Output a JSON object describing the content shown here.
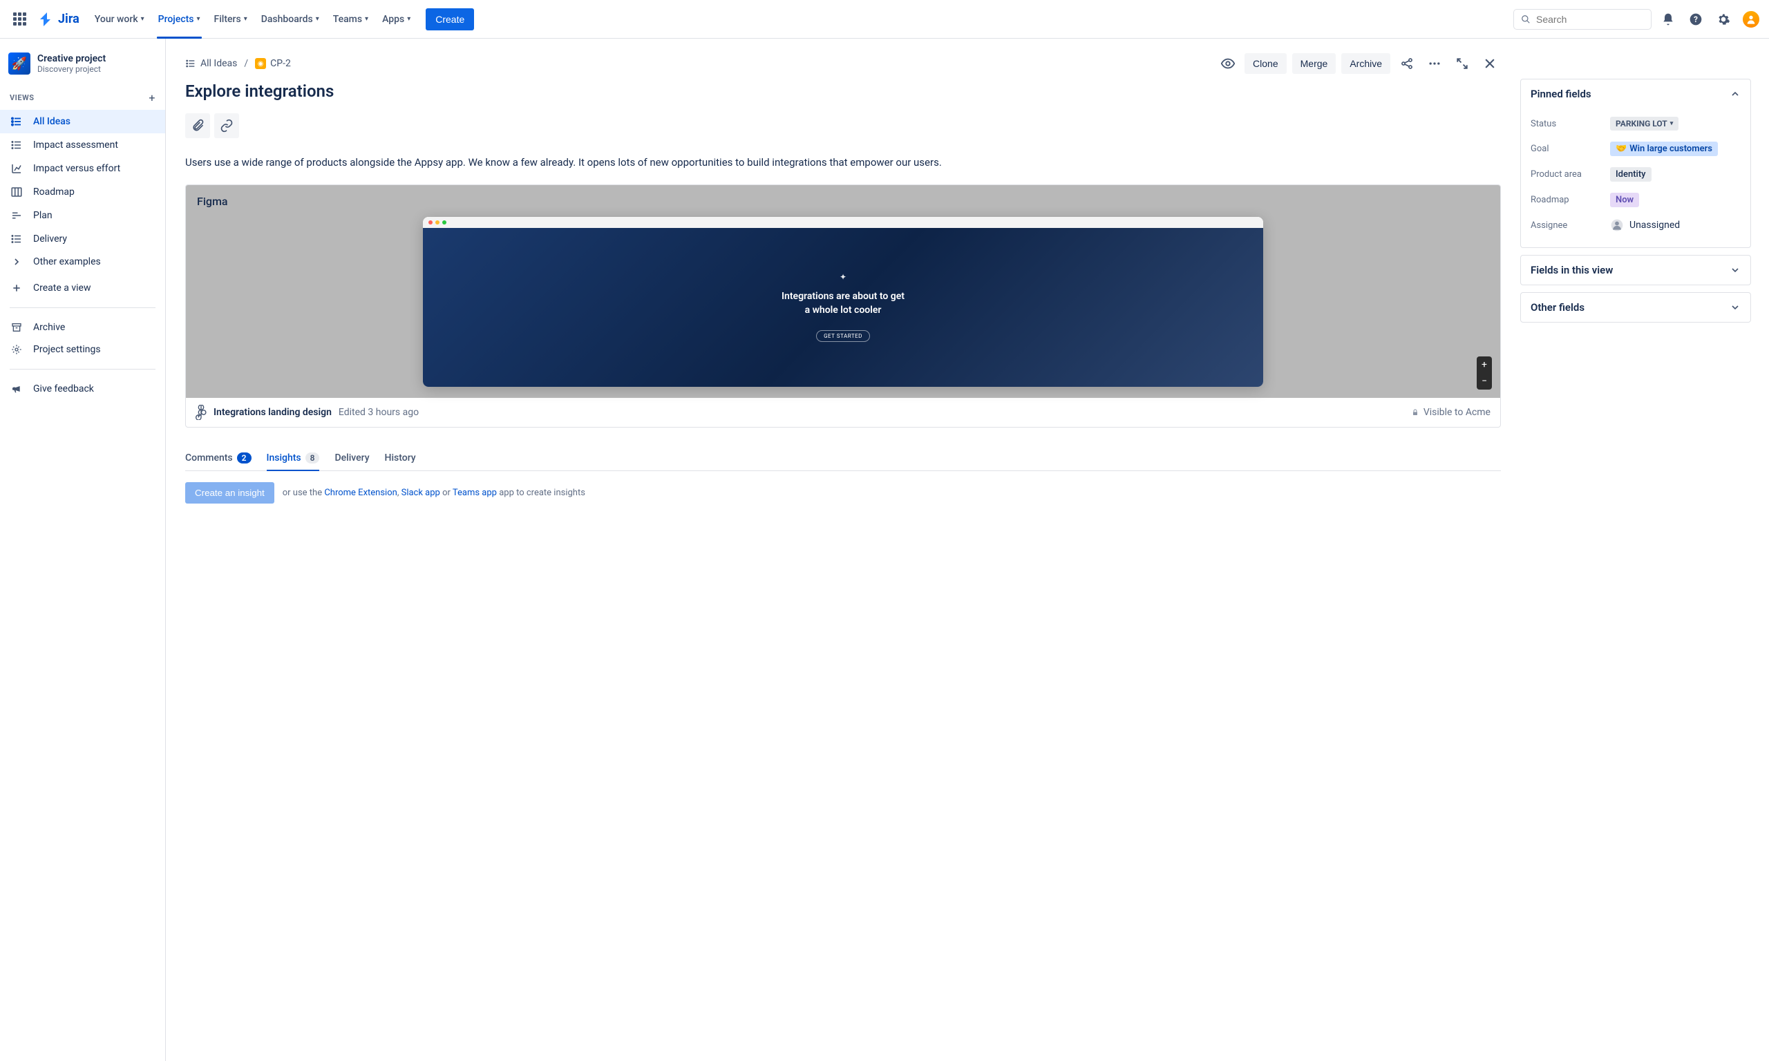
{
  "app": {
    "name": "Jira",
    "search_placeholder": "Search"
  },
  "nav": {
    "your_work": "Your work",
    "projects": "Projects",
    "filters": "Filters",
    "dashboards": "Dashboards",
    "teams": "Teams",
    "apps": "Apps",
    "create": "Create"
  },
  "project": {
    "name": "Creative project",
    "subtitle": "Discovery project"
  },
  "sidebar": {
    "views_label": "VIEWS",
    "items": [
      {
        "label": "All Ideas"
      },
      {
        "label": "Impact assessment"
      },
      {
        "label": "Impact versus effort"
      },
      {
        "label": "Roadmap"
      },
      {
        "label": "Plan"
      },
      {
        "label": "Delivery"
      },
      {
        "label": "Other examples"
      }
    ],
    "create_view": "Create a view",
    "archive": "Archive",
    "project_settings": "Project settings",
    "give_feedback": "Give feedback"
  },
  "breadcrumb": {
    "all_ideas": "All Ideas",
    "issue_key": "CP-2"
  },
  "actions": {
    "clone": "Clone",
    "merge": "Merge",
    "archive": "Archive"
  },
  "issue": {
    "title": "Explore integrations",
    "description": "Users use a wide range of products alongside the Appsy app. We know a few already. It opens lots of new opportunities to build integrations that empower our users."
  },
  "figma": {
    "label": "Figma",
    "hero_line1": "Integrations are about to get",
    "hero_line2": "a whole lot cooler",
    "cta": "GET STARTED",
    "file_name": "Integrations landing design",
    "edited": "Edited 3 hours ago",
    "visibility": "Visible to Acme"
  },
  "tabs": {
    "comments": "Comments",
    "comments_count": "2",
    "insights": "Insights",
    "insights_count": "8",
    "delivery": "Delivery",
    "history": "History"
  },
  "insight_cta": {
    "button": "Create an insight",
    "hint_prefix": "or use the ",
    "link1": "Chrome Extension",
    "mid1": ", ",
    "link2": "Slack app",
    "mid2": " or ",
    "link3": "Teams app",
    "hint_suffix": " app to create insights"
  },
  "panels": {
    "pinned": "Pinned fields",
    "fields_view": "Fields in this view",
    "other": "Other fields"
  },
  "fields": {
    "status_label": "Status",
    "status_value": "PARKING LOT",
    "goal_label": "Goal",
    "goal_value": "Win large customers",
    "area_label": "Product area",
    "area_value": "Identity",
    "roadmap_label": "Roadmap",
    "roadmap_value": "Now",
    "assignee_label": "Assignee",
    "assignee_value": "Unassigned"
  }
}
